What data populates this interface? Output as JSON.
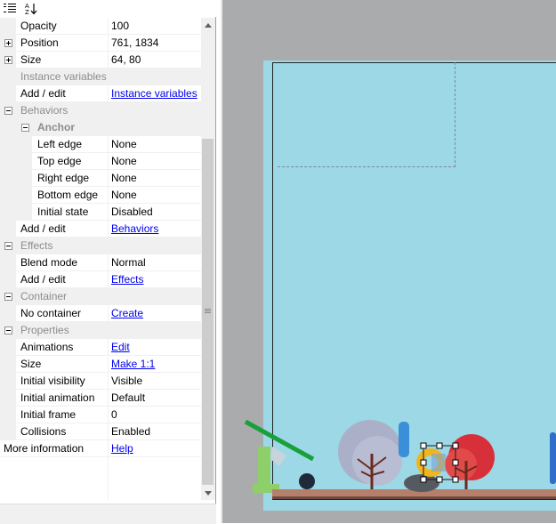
{
  "toolbar": {
    "categorized_icon": "categorized-icon",
    "sort_az_icon": "sort-az-icon"
  },
  "rows": {
    "opacity": {
      "name": "Opacity",
      "value": "100"
    },
    "position": {
      "name": "Position",
      "value": "761, 1834"
    },
    "size": {
      "name": "Size",
      "value": "64, 80"
    },
    "instance_variables_header": "Instance variables",
    "iv_add_edit": {
      "name": "Add / edit",
      "value": "Instance variables"
    },
    "behaviors_header": "Behaviors",
    "anchor_header": "Anchor",
    "left_edge": {
      "name": "Left edge",
      "value": "None"
    },
    "top_edge": {
      "name": "Top edge",
      "value": "None"
    },
    "right_edge": {
      "name": "Right edge",
      "value": "None"
    },
    "bottom_edge": {
      "name": "Bottom edge",
      "value": "None"
    },
    "initial_state": {
      "name": "Initial state",
      "value": "Disabled"
    },
    "behaviors_add_edit": {
      "name": "Add / edit",
      "value": "Behaviors"
    },
    "effects_header": "Effects",
    "blend_mode": {
      "name": "Blend mode",
      "value": "Normal"
    },
    "effects_add_edit": {
      "name": "Add / edit",
      "value": "Effects"
    },
    "container_header": "Container",
    "no_container": {
      "name": "No container",
      "value": "Create"
    },
    "properties_header": "Properties",
    "animations": {
      "name": "Animations",
      "value": "Edit"
    },
    "prop_size": {
      "name": "Size",
      "value": "Make 1:1"
    },
    "initial_visibility": {
      "name": "Initial visibility",
      "value": "Visible"
    },
    "initial_animation": {
      "name": "Initial animation",
      "value": "Default"
    },
    "initial_frame": {
      "name": "Initial frame",
      "value": "0"
    },
    "collisions": {
      "name": "Collisions",
      "value": "Enabled"
    },
    "more_information": {
      "name": "More information",
      "value": "Help"
    }
  },
  "colors": {
    "layout_background": "#9cd8e6",
    "canvas_background": "#a9abad",
    "link": "#0000ee",
    "section_header_text": "#8c8c8c"
  }
}
